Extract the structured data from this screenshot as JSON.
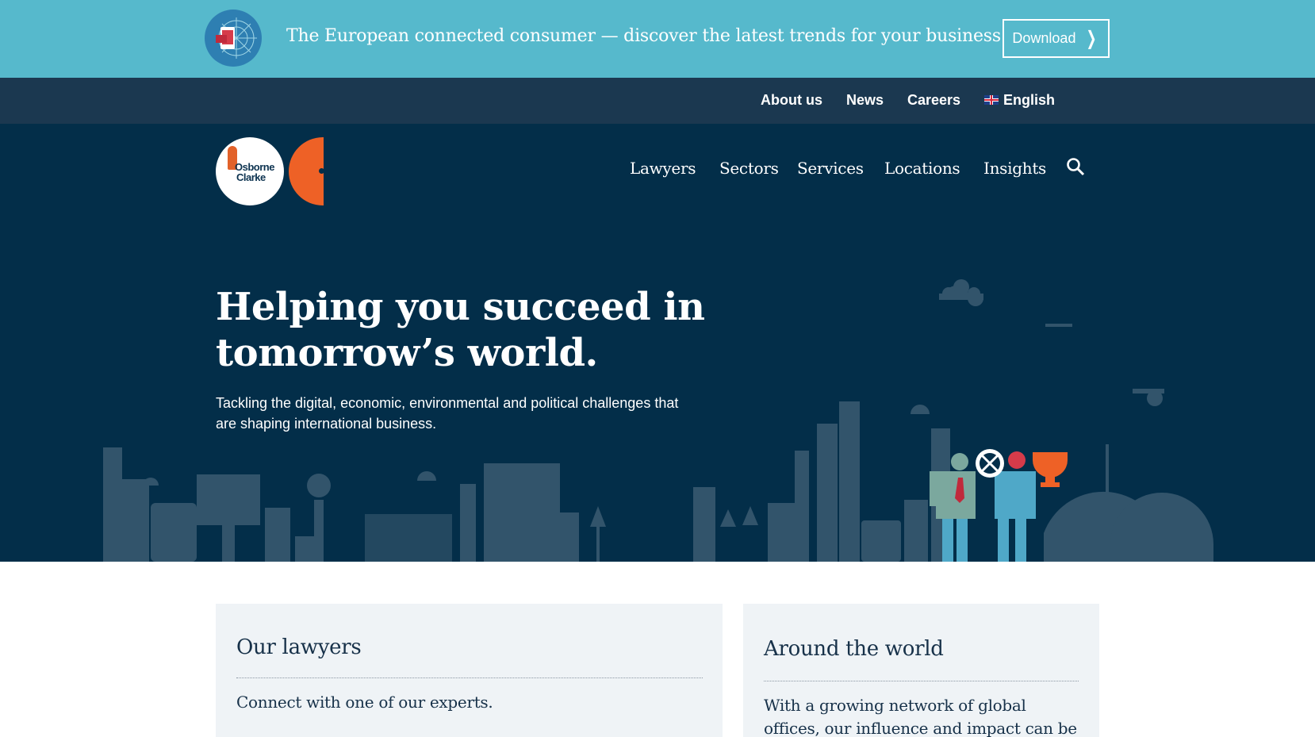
{
  "promo": {
    "text": "The European connected consumer — discover the latest trends for your business",
    "button_label": "Download"
  },
  "utility_nav": {
    "items": [
      "About us",
      "News",
      "Careers"
    ],
    "language": "English"
  },
  "brand": {
    "logo_text_1": "Osborne",
    "logo_text_2": "Clarke",
    "accent_color": "#ee6126"
  },
  "main_nav": {
    "items": [
      "Lawyers",
      "Sectors",
      "Services",
      "Locations",
      "Insights"
    ]
  },
  "hero": {
    "title_line_1": "Helping you succeed in",
    "title_line_2": "tomorrow’s world.",
    "subtitle": "Tackling the digital, economic, environmental and political challenges that are shaping international business."
  },
  "cards": {
    "lawyers": {
      "title": "Our lawyers",
      "text": "Connect with one of our experts."
    },
    "world": {
      "title": "Around the world",
      "text_line_1": "With a growing network of global",
      "text_line_2": "offices, our influence and impact can be"
    }
  },
  "colors": {
    "promo_bg": "#56b9cc",
    "utility_bg": "#1b3850",
    "hero_bg": "#032e49",
    "card_bg": "#eff3f6"
  }
}
